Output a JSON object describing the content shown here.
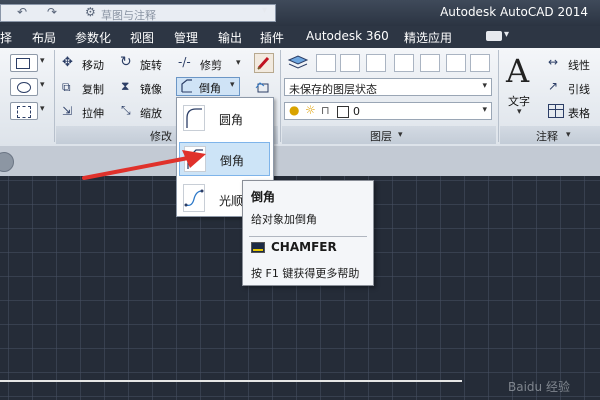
{
  "title_bar": {
    "qat_field_text": "草图与注释",
    "app_title": "Autodesk AutoCAD 2014"
  },
  "menu": {
    "items": [
      "择",
      "布局",
      "参数化",
      "视图",
      "管理",
      "输出",
      "插件",
      "Autodesk 360",
      "精选应用"
    ]
  },
  "ribbon": {
    "modify": {
      "move": "移动",
      "rotate": "旋转",
      "trim": "修剪",
      "chamfer": "倒角",
      "copy": "复制",
      "mirror": "镜像",
      "stretch": "拉伸",
      "scale": "缩放",
      "panel_title": "修改"
    },
    "layers": {
      "layer_state": "未保存的图层状态",
      "layer_value": "0",
      "panel_title": "图层"
    },
    "annotation": {
      "text": "文字",
      "linear": "线性",
      "leader": "引线",
      "table": "表格",
      "panel_title": "注释"
    }
  },
  "dropdown": {
    "items": [
      "圆角",
      "倒角",
      "光顺曲线"
    ]
  },
  "tooltip": {
    "title": "倒角",
    "description": "给对象加倒角",
    "command": "CHAMFER",
    "help": "按 F1 键获得更多帮助"
  },
  "watermark": "Baidu 经验",
  "colors": {
    "canvas_bg": "#252c38",
    "arrow": "#e0312b",
    "selected_highlight": "#cde4f7",
    "titlebar_bg": "#2b3442"
  }
}
